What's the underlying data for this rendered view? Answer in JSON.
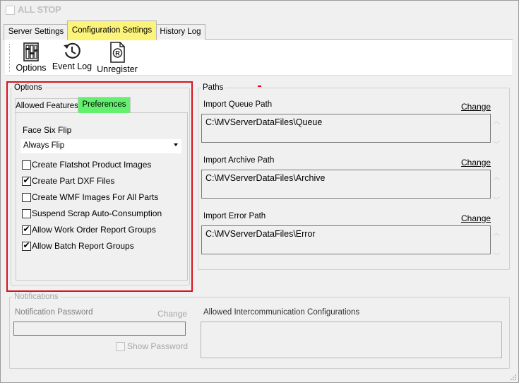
{
  "all_stop": {
    "label": "ALL STOP",
    "checked": false
  },
  "tabs": [
    {
      "label": "Server Settings",
      "active": false
    },
    {
      "label": "Configuration Settings",
      "active": true
    },
    {
      "label": "History Log",
      "active": false
    }
  ],
  "toolbar": [
    {
      "label": "Options",
      "icon": "options-icon"
    },
    {
      "label": "Event Log",
      "icon": "history-icon"
    },
    {
      "label": "Unregister",
      "icon": "unregister-icon"
    }
  ],
  "options": {
    "title": "Options",
    "tabs": [
      {
        "label": "Allowed Features",
        "active": false
      },
      {
        "label": "Preferences",
        "active": true
      }
    ],
    "face_six_flip_label": "Face Six Flip",
    "face_six_flip_value": "Always Flip",
    "checkboxes": [
      {
        "label": "Create Flatshot Product Images",
        "checked": false
      },
      {
        "label": "Create Part DXF Files",
        "checked": true
      },
      {
        "label": "Create WMF Images For All Parts",
        "checked": false
      },
      {
        "label": "Suspend Scrap Auto-Consumption",
        "checked": false
      },
      {
        "label": "Allow Work Order Report Groups",
        "checked": true
      },
      {
        "label": "Allow Batch Report Groups",
        "checked": true
      }
    ]
  },
  "paths": {
    "title": "Paths",
    "change_label": "Change",
    "items": [
      {
        "label": "Import Queue Path",
        "value": "C:\\MVServerDataFiles\\Queue"
      },
      {
        "label": "Import Archive Path",
        "value": "C:\\MVServerDataFiles\\Archive"
      },
      {
        "label": "Import Error Path",
        "value": "C:\\MVServerDataFiles\\Error"
      }
    ]
  },
  "notifications": {
    "title": "Notifications",
    "password_label": "Notification Password",
    "change_label": "Change",
    "password_value": "",
    "show_password_label": "Show Password",
    "allowed_label": "Allowed Intercommunication Configurations"
  },
  "colors": {
    "active_tab": "#fbf37a",
    "active_inner_tab": "#62f06d",
    "highlight_frame": "#d8121e"
  }
}
